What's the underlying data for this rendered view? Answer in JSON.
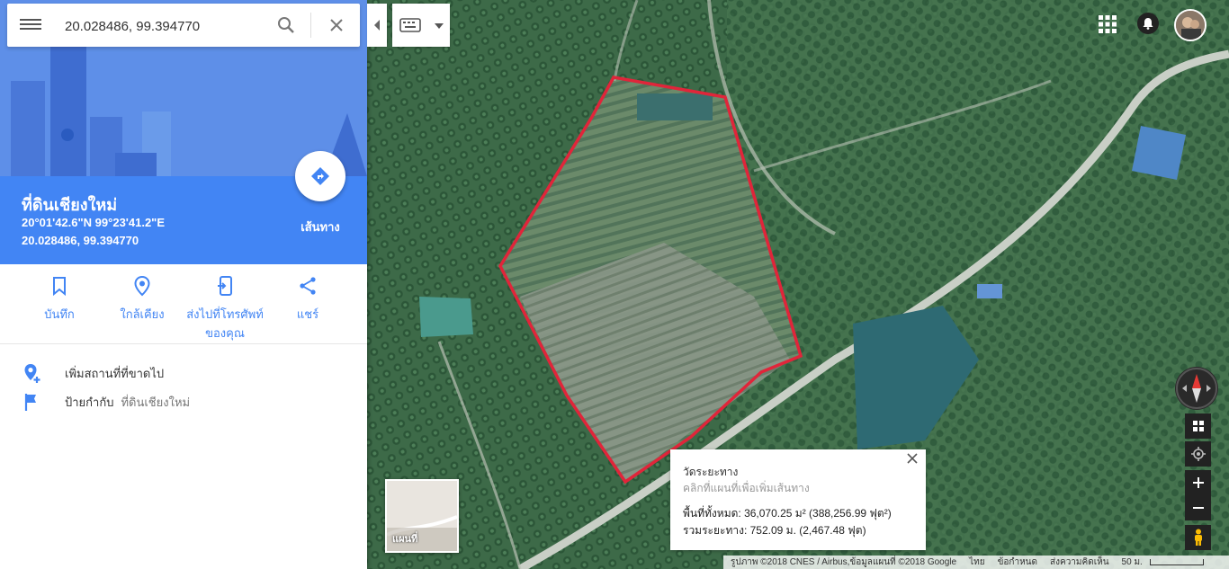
{
  "search": {
    "value": "20.028486, 99.394770"
  },
  "place": {
    "title": "ที่ดินเชียงใหม่",
    "dms": "20°01'42.6\"N 99°23'41.2\"E",
    "decimal": "20.028486, 99.394770",
    "directions_label": "เส้นทาง"
  },
  "actions": {
    "save": "บันทึก",
    "nearby": "ใกล้เคียง",
    "send_line1": "ส่งไปที่โทรศัพท์",
    "send_line2": "ของคุณ",
    "share": "แชร์"
  },
  "details": {
    "add_missing": "เพิ่มสถานที่ที่ขาดไป",
    "label_prefix": "ป้ายกำกับ",
    "label_value": "ที่ดินเชียงใหม่"
  },
  "layer": {
    "label": "แผนที่"
  },
  "measure": {
    "title": "วัดระยะทาง",
    "hint": "คลิกที่แผนที่เพื่อเพิ่มเส้นทาง",
    "area": "พื้นที่ทั้งหมด: 36,070.25 ม² (388,256.99 ฟุต²)",
    "distance": "รวมระยะทาง: 752.09 ม. (2,467.48 ฟุต)"
  },
  "attribution": {
    "imagery": "รูปภาพ ©2018 CNES / Airbus,ข้อมูลแผนที่ ©2018 Google",
    "language": "ไทย",
    "terms": "ข้อกำหนด",
    "feedback": "ส่งความคิดเห็น",
    "scale": "50 ม."
  },
  "colors": {
    "accent": "#4285f4",
    "polygon": "#e0253a",
    "hero": "#5e8fe8"
  }
}
